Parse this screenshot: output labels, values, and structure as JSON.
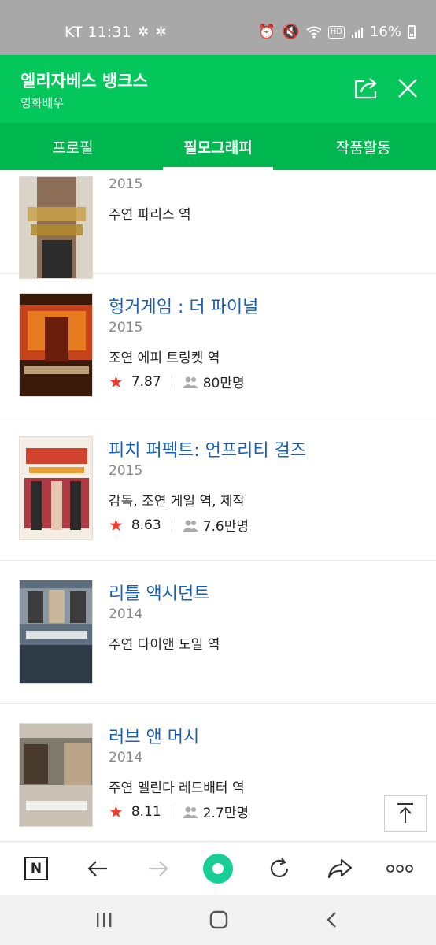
{
  "status_bar": {
    "carrier_time": "KT 11:31",
    "hd_label": "HD",
    "battery_percent": "16%"
  },
  "header": {
    "title": "엘리자베스 뱅크스",
    "subtitle": "영화배우"
  },
  "tabs": [
    {
      "label": "프로필",
      "active": false
    },
    {
      "label": "필모그래피",
      "active": true
    },
    {
      "label": "작품활동",
      "active": false
    }
  ],
  "films": [
    {
      "title": "",
      "year": "2015",
      "role": "주연 파리스 역",
      "rating": "",
      "audience": "",
      "poster_caption": "MAGIC MIKE XXL"
    },
    {
      "title": "헝거게임 : 더 파이널",
      "year": "2015",
      "role": "조연 에피 트링켓 역",
      "rating": "7.87",
      "audience": "80만명",
      "poster_caption": "헝거게임"
    },
    {
      "title": "피치 퍼펙트: 언프리티 걸즈",
      "year": "2015",
      "role": "감독, 조연 게일 역, 제작",
      "rating": "8.63",
      "audience": "7.6만명",
      "poster_caption": "피치 퍼펙트"
    },
    {
      "title": "리틀 액시던트",
      "year": "2014",
      "role": "주연 다이앤 도일 역",
      "rating": "",
      "audience": "",
      "poster_caption": "리틀 액시던트"
    },
    {
      "title": "러브 앤 머시",
      "year": "2014",
      "role": "주연 멜린다 레드배터 역",
      "rating": "8.11",
      "audience": "2.7만명",
      "poster_caption": "러브 앤 머시"
    }
  ],
  "toolbar": {
    "naver_logo": "N"
  },
  "colors": {
    "brand_green": "#03c75a",
    "tab_green": "#00b64e",
    "link_blue": "#1a5fb4",
    "star_red": "#f23d2d"
  },
  "icons": [
    "share-icon",
    "close-icon",
    "star-icon",
    "people-icon",
    "arrow-up-icon",
    "back-arrow-icon",
    "forward-arrow-icon",
    "home-dot-icon",
    "refresh-icon",
    "share-arrow-icon",
    "more-icon",
    "recent-apps-icon",
    "home-icon",
    "nav-back-icon"
  ]
}
